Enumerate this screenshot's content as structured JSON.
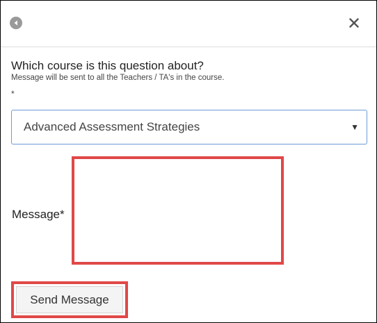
{
  "header": {
    "back_icon": "arrow-left-circle-icon",
    "close_icon": "close-icon",
    "close_glyph": "✕"
  },
  "form": {
    "question": "Which course is this question about?",
    "hint": "Message will be sent to all the Teachers / TA's in the course.",
    "required_marker": "*",
    "course_select": {
      "selected": "Advanced Assessment Strategies",
      "arrow_glyph": "▼"
    },
    "message_label": "Message*",
    "message_value": "",
    "send_label": "Send Message"
  },
  "colors": {
    "highlight_border": "#e04848",
    "select_border": "#6b9bd6",
    "back_icon": "#9a9a9a"
  }
}
